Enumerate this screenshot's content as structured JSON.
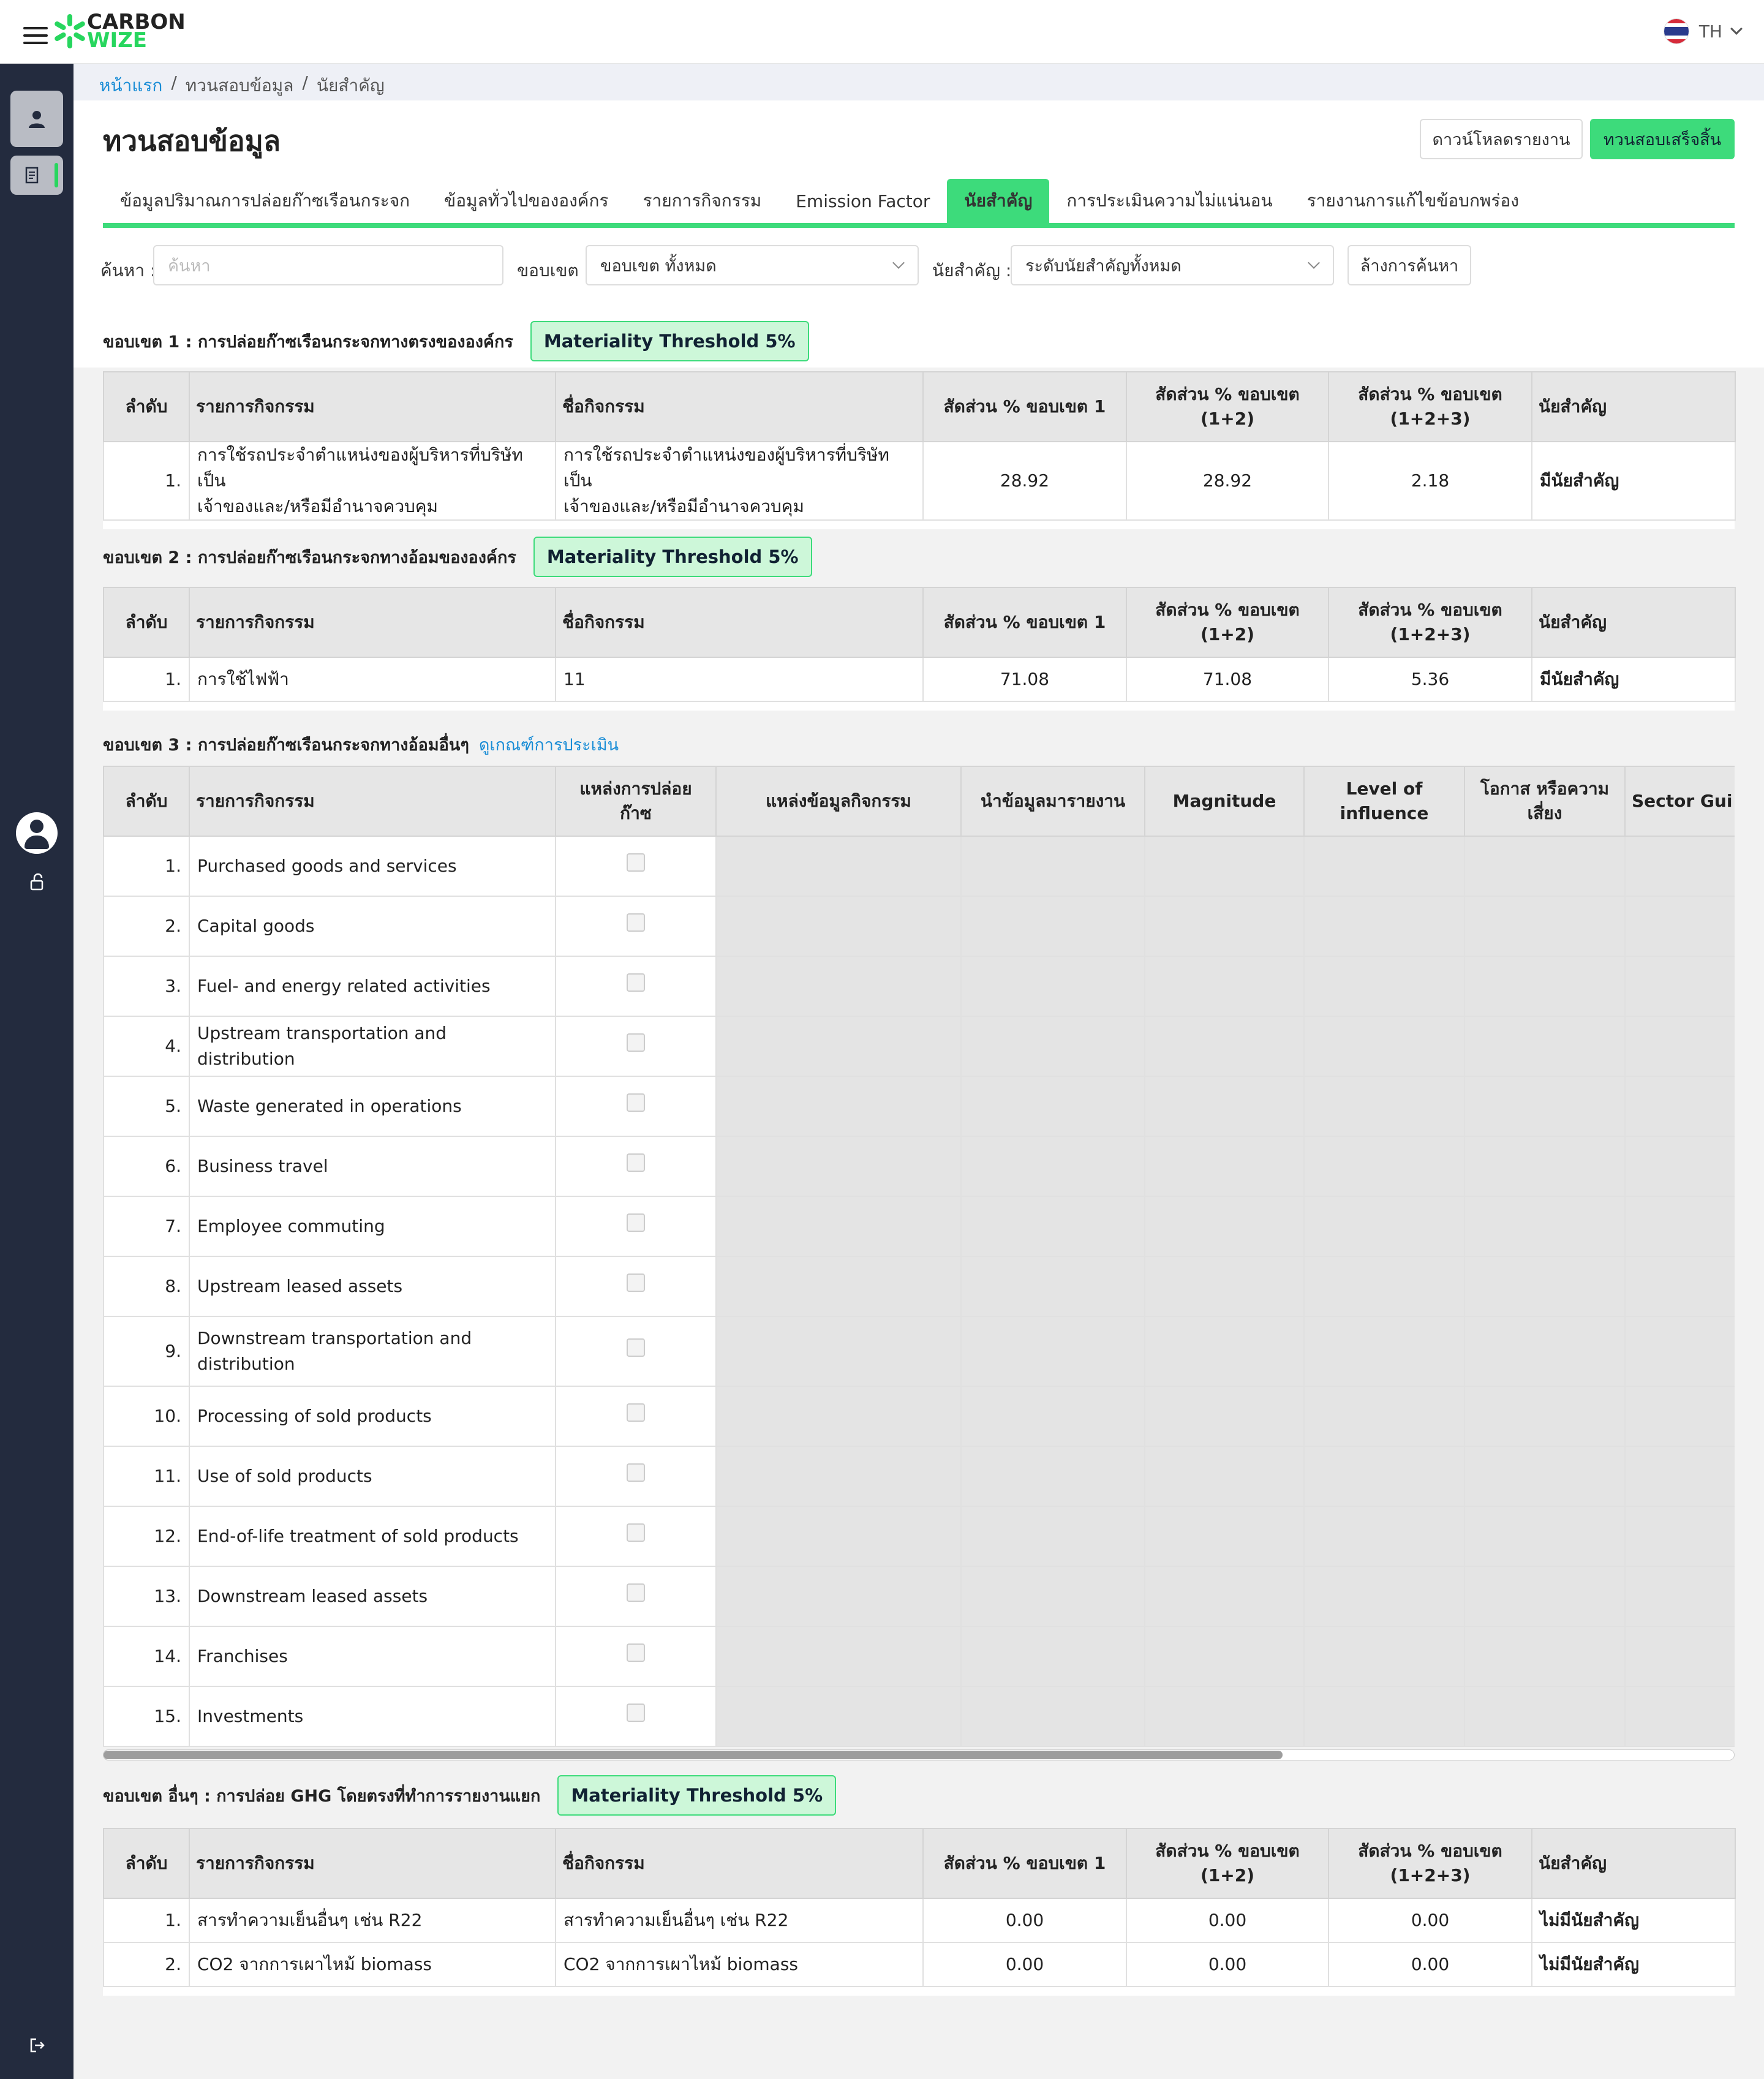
{
  "app": {
    "logo_line1": "CARBON",
    "logo_line2": "WIZE",
    "lang": "TH",
    "accent": "#3ddb7b"
  },
  "icons": [
    "menu-icon",
    "user-icon",
    "document-icon",
    "account-circle-icon",
    "unlock-icon",
    "logout-icon",
    "chevron-down-icon"
  ],
  "breadcrumb": {
    "home": "หน้าแรก",
    "sep": "/",
    "level2": "ทวนสอบข้อมูล",
    "level3": "นัยสำคัญ"
  },
  "page": {
    "title": "ทวนสอบข้อมูล",
    "download_label": "ดาวน์โหลดรายงาน",
    "finish_label": "ทวนสอบเสร็จสิ้น"
  },
  "tabs": [
    {
      "label": "ข้อมูลปริมาณการปล่อยก๊าซเรือนกระจก"
    },
    {
      "label": "ข้อมูลทั่วไปขององค์กร"
    },
    {
      "label": "รายการกิจกรรม"
    },
    {
      "label": "Emission Factor"
    },
    {
      "label": "นัยสำคัญ"
    },
    {
      "label": "การประเมินความไม่แน่นอน"
    },
    {
      "label": "รายงานการแก้ไขข้อบกพร่อง"
    }
  ],
  "filters": {
    "search_label": "ค้นหา :",
    "search_placeholder": "ค้นหา",
    "scope_label": "ขอบเขต :",
    "scope_value": "ขอบเขต ทั้งหมด",
    "significance_label": "นัยสำคัญ :",
    "significance_value": "ระดับนัยสำคัญทั้งหมด",
    "clear_label": "ล้างการค้นหา"
  },
  "headers": {
    "no": "ลำดับ",
    "activity_list": "รายการกิจกรรม",
    "activity_name": "ชื่อกิจกรรม",
    "pct_scope1": "สัดส่วน % ขอบเขต 1",
    "pct_scope12_a": "สัดส่วน % ขอบเขต",
    "pct_scope12_b": "(1+2)",
    "pct_scope123_a": "สัดส่วน % ขอบเขต",
    "pct_scope123_b": "(1+2+3)",
    "significance": "นัยสำคัญ"
  },
  "threshold_label": "Materiality Threshold 5%",
  "scope1": {
    "title": "ขอบเขต 1 : การปล่อยก๊าซเรือนกระจกทางตรงขององค์กร",
    "rows": [
      {
        "no": "1.",
        "activity_l1": "การใช้รถประจำตำแหน่งของผู้บริหารที่บริษัทเป็น",
        "activity_l2": "เจ้าของและ/หรือมีอำนาจควบคุม",
        "name_l1": "การใช้รถประจำตำแหน่งของผู้บริหารที่บริษัทเป็น",
        "name_l2": "เจ้าของและ/หรือมีอำนาจควบคุม",
        "p1": "28.92",
        "p12": "28.92",
        "p123": "2.18",
        "sig": "มีนัยสำคัญ"
      }
    ]
  },
  "scope2": {
    "title": "ขอบเขต 2 : การปล่อยก๊าซเรือนกระจกทางอ้อมขององค์กร",
    "rows": [
      {
        "no": "1.",
        "activity": "การใช้ไฟฟ้า",
        "name": "11",
        "p1": "71.08",
        "p12": "71.08",
        "p123": "5.36",
        "sig": "มีนัยสำคัญ"
      }
    ]
  },
  "scope3": {
    "title": "ขอบเขต 3 : การปล่อยก๊าซเรือนกระจกทางอ้อมอื่นๆ",
    "link": "ดูเกณฑ์การประเมิน",
    "headers": {
      "no": "ลำดับ",
      "activity_list": "รายการกิจกรรม",
      "source_a": "แหล่งการปล่อย",
      "source_b": "ก๊าซ",
      "data_source": "แหล่งข้อมูลกิจกรรม",
      "report": "นำข้อมูลมารายงาน",
      "magnitude": "Magnitude",
      "influence_a": "Level of",
      "influence_b": "influence",
      "risk_a": "โอกาส หรือความ",
      "risk_b": "เสี่ยง",
      "sector": "Sector Gui"
    },
    "rows": [
      {
        "no": "1.",
        "l1": "Purchased goods and services",
        "l2": ""
      },
      {
        "no": "2.",
        "l1": "Capital goods",
        "l2": ""
      },
      {
        "no": "3.",
        "l1": "Fuel- and energy related activities",
        "l2": ""
      },
      {
        "no": "4.",
        "l1": "Upstream transportation and distribution",
        "l2": ""
      },
      {
        "no": "5.",
        "l1": "Waste generated in operations",
        "l2": ""
      },
      {
        "no": "6.",
        "l1": "Business travel",
        "l2": ""
      },
      {
        "no": "7.",
        "l1": "Employee commuting",
        "l2": ""
      },
      {
        "no": "8.",
        "l1": "Upstream leased assets",
        "l2": ""
      },
      {
        "no": "9.",
        "l1": "Downstream transportation and",
        "l2": "distribution"
      },
      {
        "no": "10.",
        "l1": "Processing of sold products",
        "l2": ""
      },
      {
        "no": "11.",
        "l1": "Use of sold products",
        "l2": ""
      },
      {
        "no": "12.",
        "l1": "End-of-life treatment of sold products",
        "l2": ""
      },
      {
        "no": "13.",
        "l1": "Downstream leased assets",
        "l2": ""
      },
      {
        "no": "14.",
        "l1": "Franchises",
        "l2": ""
      },
      {
        "no": "15.",
        "l1": "Investments",
        "l2": ""
      }
    ]
  },
  "other": {
    "title": "ขอบเขต อื่นๆ : การปล่อย GHG โดยตรงที่ทำการรายงานแยก",
    "rows": [
      {
        "no": "1.",
        "activity": "สารทำความเย็นอื่นๆ เช่น R22",
        "name": "สารทำความเย็นอื่นๆ เช่น R22",
        "p1": "0.00",
        "p12": "0.00",
        "p123": "0.00",
        "sig": "ไม่มีนัยสำคัญ"
      },
      {
        "no": "2.",
        "activity": "CO2 จากการเผาไหม้ biomass",
        "name": "CO2 จากการเผาไหม้ biomass",
        "p1": "0.00",
        "p12": "0.00",
        "p123": "0.00",
        "sig": "ไม่มีนัยสำคัญ"
      }
    ]
  }
}
